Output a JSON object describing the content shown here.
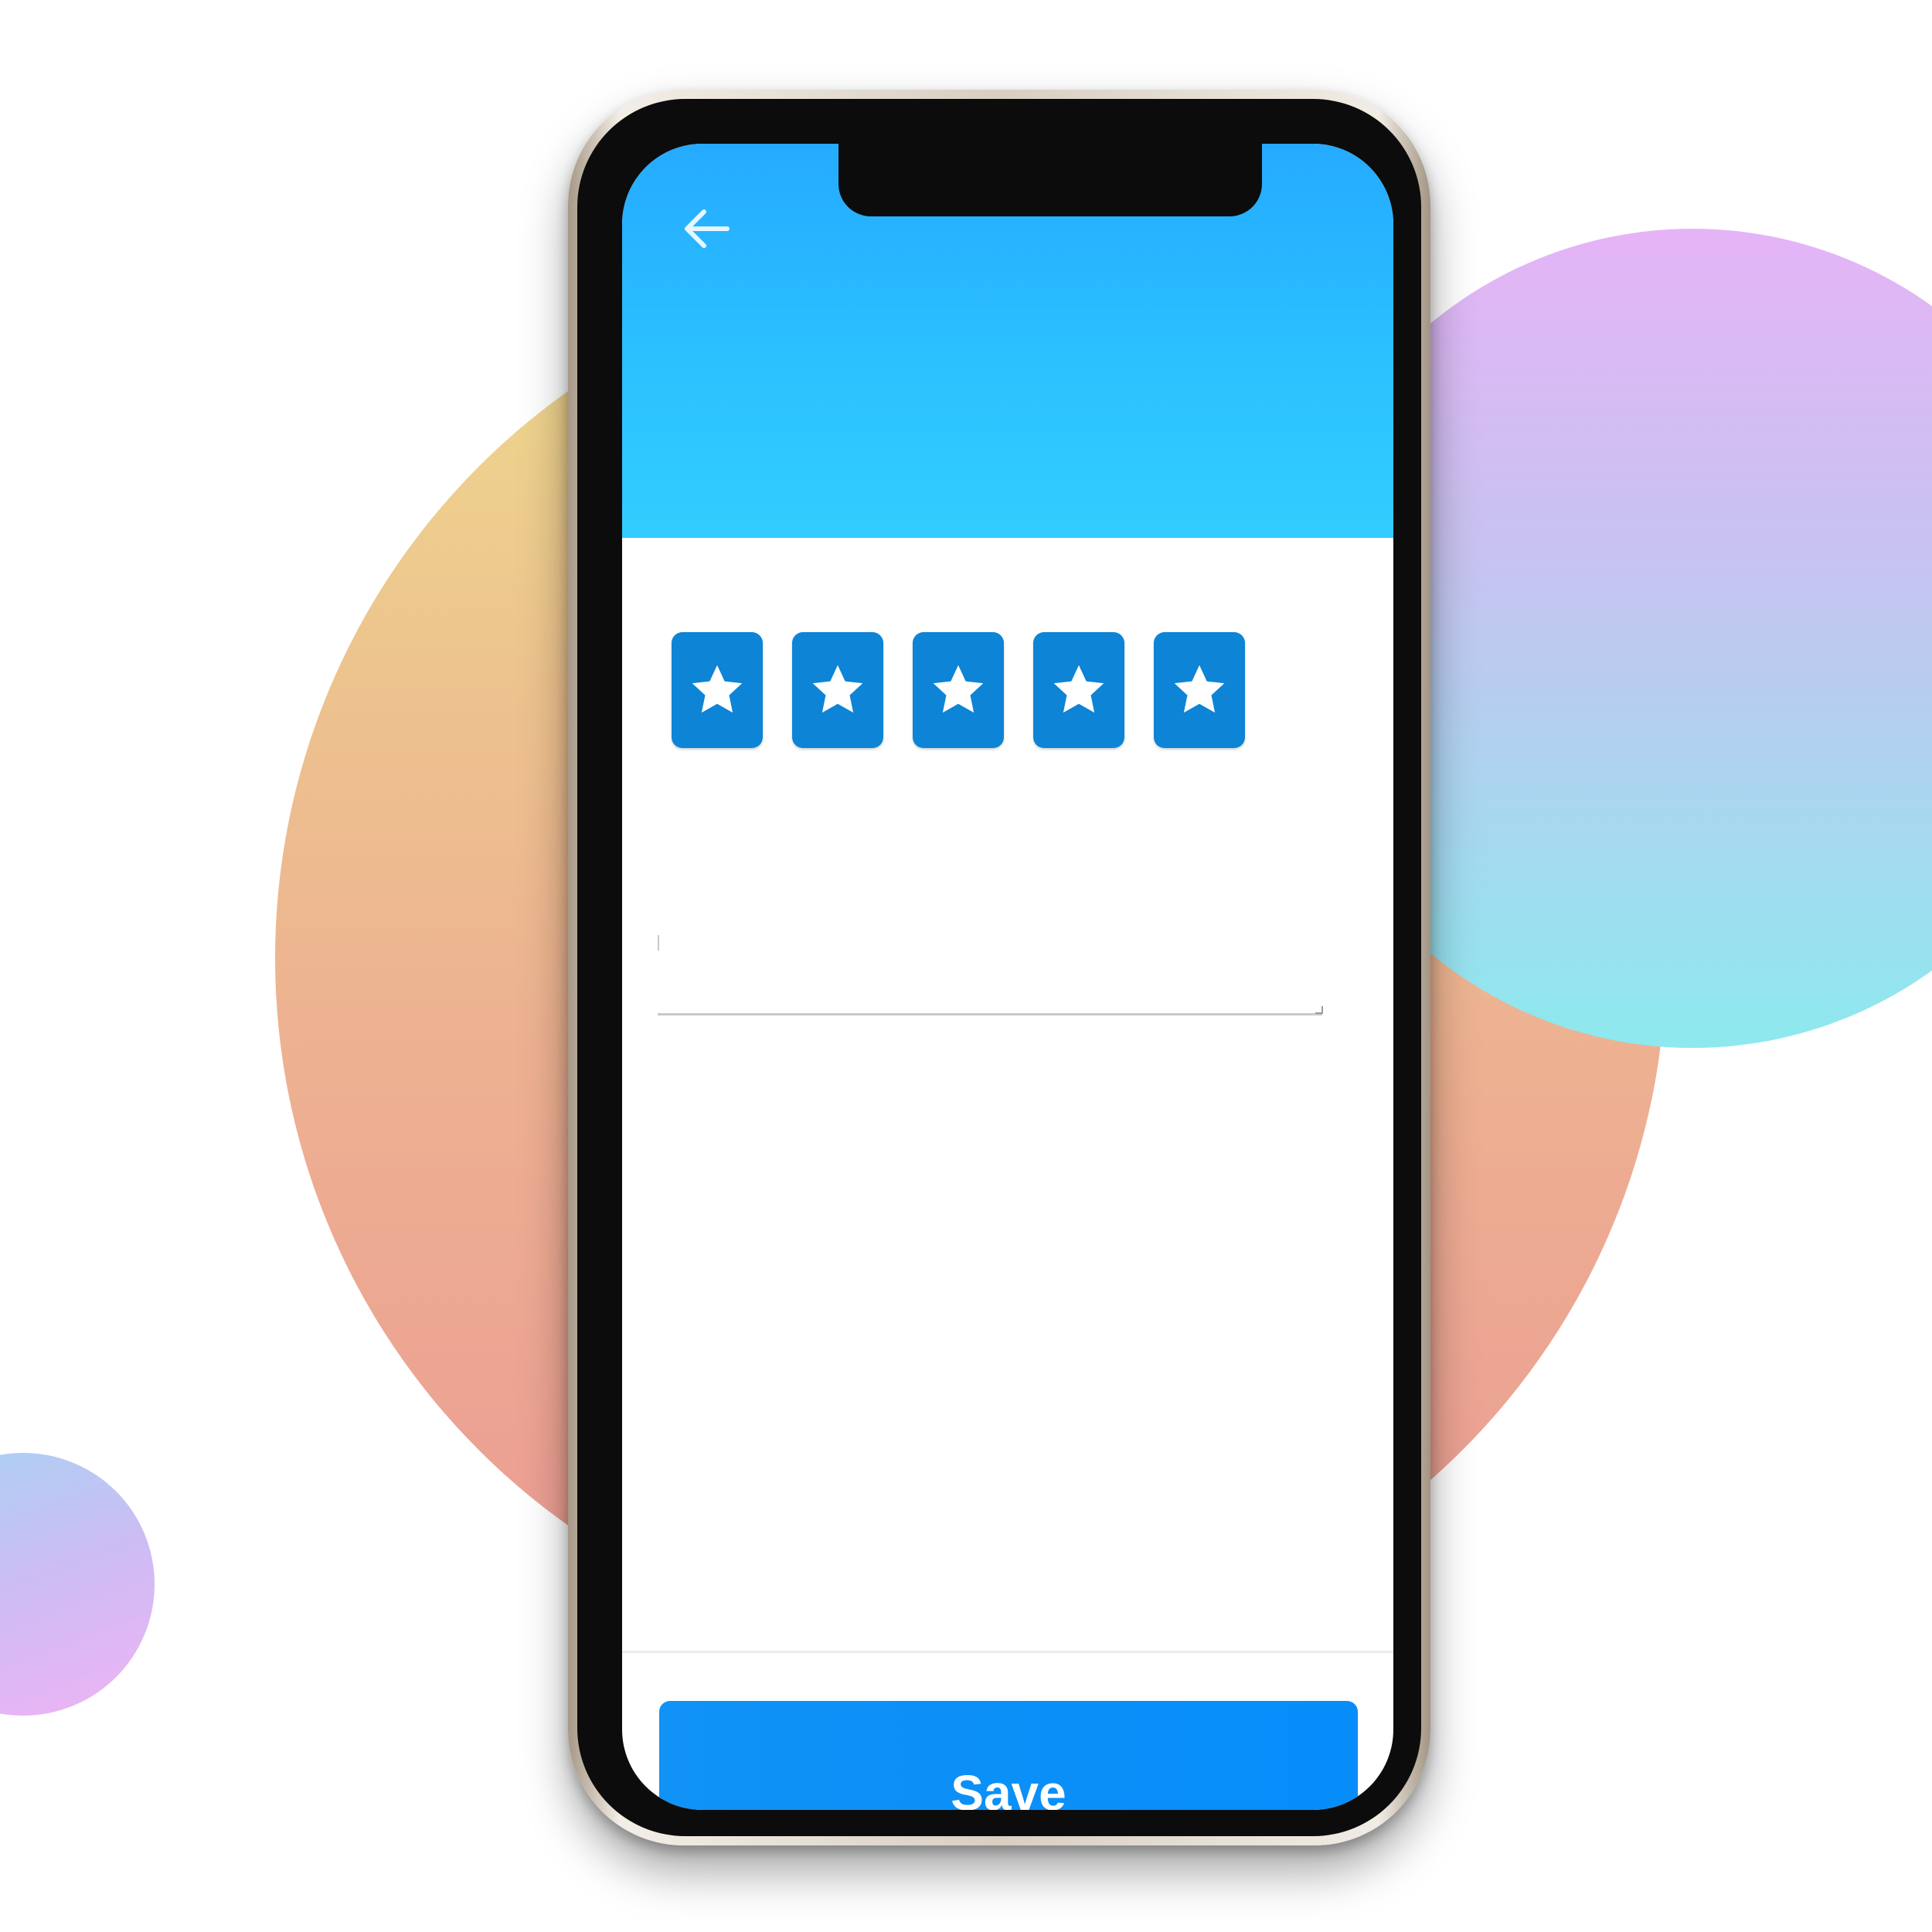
{
  "colors": {
    "header_gradient_top": "#25aaff",
    "header_gradient_bottom": "#32cdff",
    "star_box": "#0d84d6",
    "save_button": "#068dfa",
    "save_text": "#ffffff"
  },
  "header": {
    "back_icon": "arrow-left-icon"
  },
  "rating": {
    "value": 5,
    "max": 5,
    "star_icon": "star-icon"
  },
  "comment": {
    "value": "",
    "placeholder": ""
  },
  "footer": {
    "save_label": "Save"
  }
}
